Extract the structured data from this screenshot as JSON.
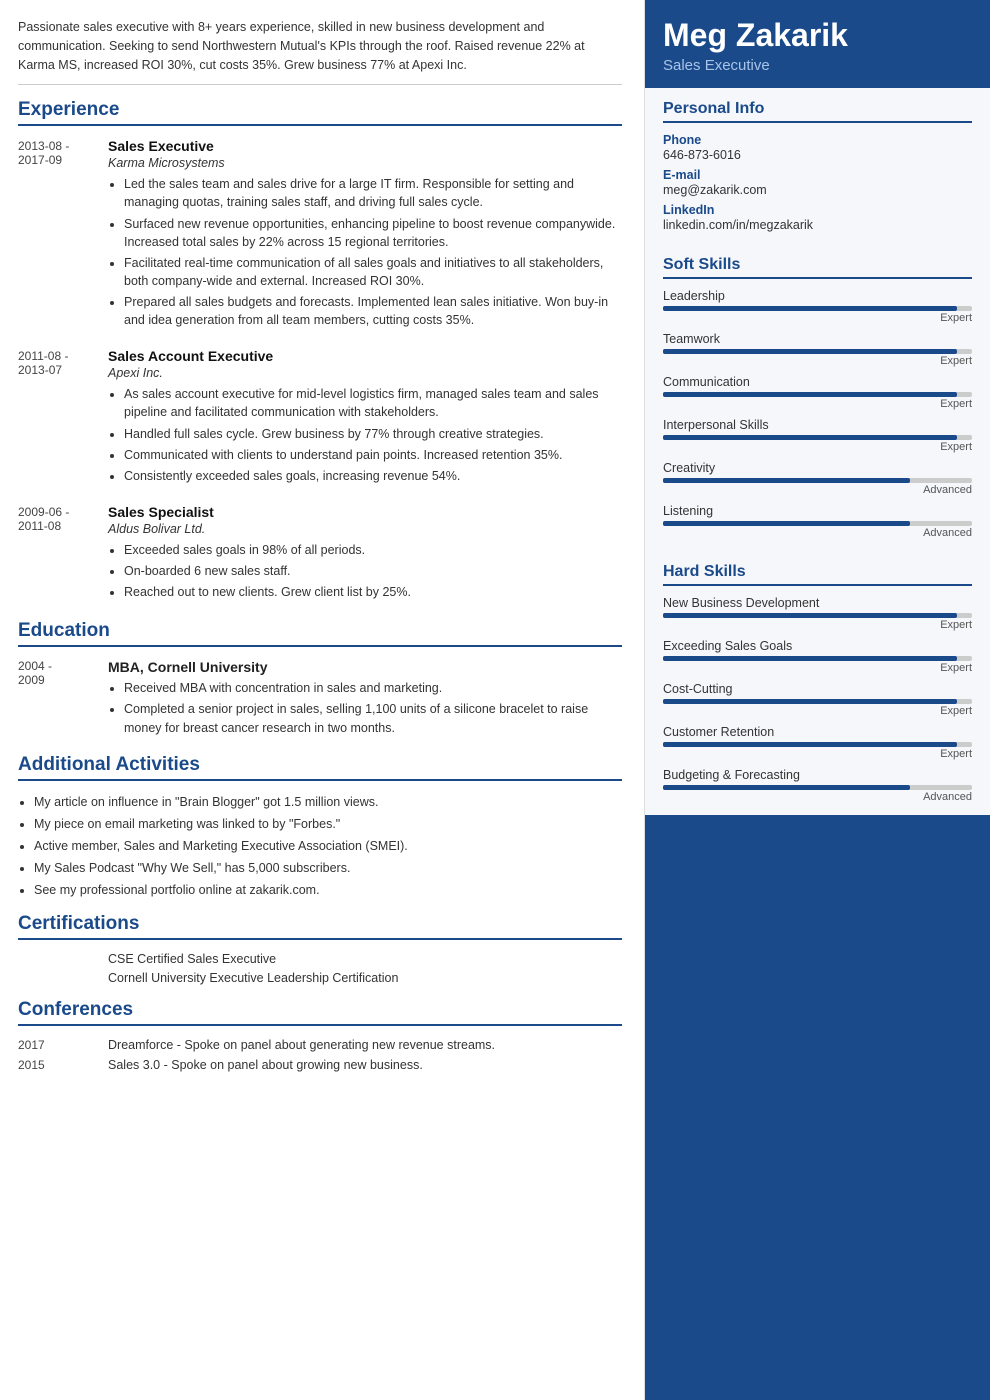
{
  "resume": {
    "name": "Meg Zakarik",
    "title": "Sales Executive",
    "summary": "Passionate sales executive with 8+ years experience, skilled in new business development and communication. Seeking to send Northwestern Mutual's KPIs through the roof. Raised revenue 22% at Karma MS, increased ROI 30%, cut costs 35%. Grew business 77% at Apexi Inc.",
    "personal_info": {
      "label": "Personal Info",
      "phone_label": "Phone",
      "phone": "646-873-6016",
      "email_label": "E-mail",
      "email": "meg@zakarik.com",
      "linkedin_label": "LinkedIn",
      "linkedin": "linkedin.com/in/megzakarik"
    },
    "experience": {
      "section_title": "Experience",
      "entries": [
        {
          "start": "2013-08 -",
          "end": "2017-09",
          "title": "Sales Executive",
          "company": "Karma Microsystems",
          "bullets": [
            "Led the sales team and sales drive for a large IT firm. Responsible for setting and managing quotas, training sales staff, and driving full sales cycle.",
            "Surfaced new revenue opportunities, enhancing pipeline to boost revenue companywide. Increased total sales by 22% across 15 regional territories.",
            "Facilitated real-time communication of all sales goals and initiatives to all stakeholders, both company-wide and external. Increased ROI 30%.",
            "Prepared all sales budgets and forecasts. Implemented lean sales initiative. Won buy-in and idea generation from all team members, cutting costs 35%."
          ]
        },
        {
          "start": "2011-08 -",
          "end": "2013-07",
          "title": "Sales Account Executive",
          "company": "Apexi Inc.",
          "bullets": [
            "As sales account executive for mid-level logistics firm, managed sales team and sales pipeline and facilitated communication with stakeholders.",
            "Handled full sales cycle. Grew business by 77% through creative strategies.",
            "Communicated with clients to understand pain points. Increased retention 35%.",
            "Consistently exceeded sales goals, increasing revenue 54%."
          ]
        },
        {
          "start": "2009-06 -",
          "end": "2011-08",
          "title": "Sales Specialist",
          "company": "Aldus Bolivar Ltd.",
          "bullets": [
            "Exceeded sales goals in 98% of all periods.",
            "On-boarded 6 new sales staff.",
            "Reached out to new clients. Grew client list by 25%."
          ]
        }
      ]
    },
    "education": {
      "section_title": "Education",
      "entries": [
        {
          "start": "2004 -",
          "end": "2009",
          "degree": "MBA, Cornell University",
          "bullets": [
            "Received MBA with concentration in sales and marketing.",
            "Completed a senior project in sales, selling 1,100 units of a silicone bracelet to raise money for breast cancer research in two months."
          ]
        }
      ]
    },
    "additional": {
      "section_title": "Additional Activities",
      "bullets": [
        "My article on influence in \"Brain Blogger\" got 1.5 million views.",
        "My piece on email marketing was linked to by \"Forbes.\"",
        "Active member, Sales and Marketing Executive Association (SMEI).",
        "My Sales Podcast \"Why We Sell,\" has 5,000 subscribers.",
        "See my professional portfolio online at zakarik.com."
      ]
    },
    "certifications": {
      "section_title": "Certifications",
      "items": [
        "CSE Certified Sales Executive",
        "Cornell University Executive Leadership Certification"
      ]
    },
    "conferences": {
      "section_title": "Conferences",
      "entries": [
        {
          "year": "2017",
          "description": "Dreamforce - Spoke on panel about generating new revenue streams."
        },
        {
          "year": "2015",
          "description": "Sales 3.0 - Spoke on panel about growing new business."
        }
      ]
    },
    "soft_skills": {
      "section_title": "Soft Skills",
      "skills": [
        {
          "name": "Leadership",
          "level": "Expert",
          "percent": 95
        },
        {
          "name": "Teamwork",
          "level": "Expert",
          "percent": 95
        },
        {
          "name": "Communication",
          "level": "Expert",
          "percent": 95
        },
        {
          "name": "Interpersonal Skills",
          "level": "Expert",
          "percent": 95
        },
        {
          "name": "Creativity",
          "level": "Advanced",
          "percent": 80
        },
        {
          "name": "Listening",
          "level": "Advanced",
          "percent": 80
        }
      ]
    },
    "hard_skills": {
      "section_title": "Hard Skills",
      "skills": [
        {
          "name": "New Business Development",
          "level": "Expert",
          "percent": 95
        },
        {
          "name": "Exceeding Sales Goals",
          "level": "Expert",
          "percent": 95
        },
        {
          "name": "Cost-Cutting",
          "level": "Expert",
          "percent": 95
        },
        {
          "name": "Customer Retention",
          "level": "Expert",
          "percent": 95
        },
        {
          "name": "Budgeting & Forecasting",
          "level": "Advanced",
          "percent": 80
        }
      ]
    }
  }
}
